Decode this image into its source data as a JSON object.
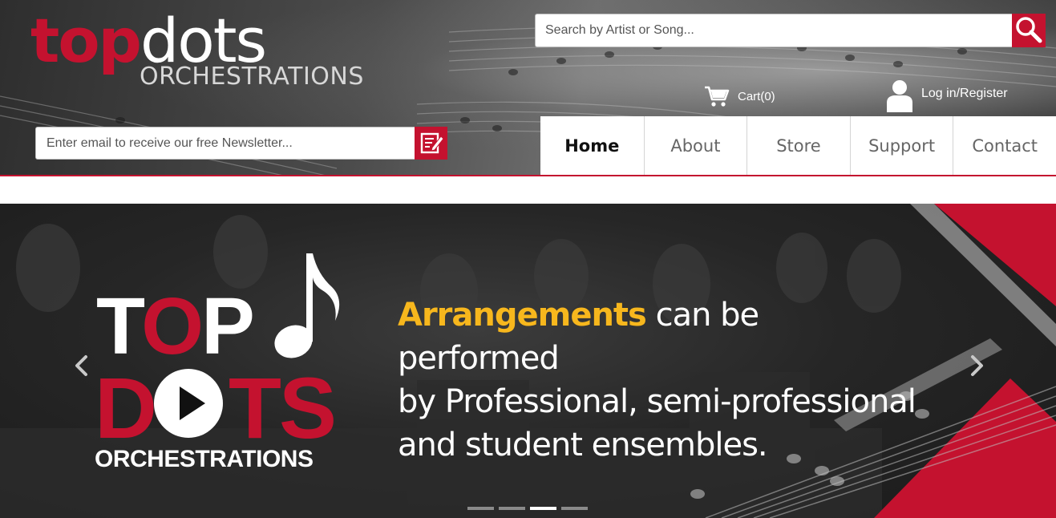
{
  "header": {
    "logo": {
      "part1": "top",
      "part2": "dots",
      "subtitle": "ORCHESTRATIONS"
    },
    "search": {
      "placeholder": "Search by Artist or Song...",
      "value": ""
    },
    "cart": {
      "label": "Cart(0)"
    },
    "account": {
      "label": "Log in/Register"
    },
    "newsletter": {
      "placeholder": "Enter email to receive our free Newsletter...",
      "value": ""
    },
    "nav": [
      {
        "label": "Home",
        "active": true
      },
      {
        "label": "About",
        "active": false
      },
      {
        "label": "Store",
        "active": false
      },
      {
        "label": "Support",
        "active": false
      },
      {
        "label": "Contact",
        "active": false
      }
    ]
  },
  "hero": {
    "logo": {
      "top_t": "T",
      "top_o": "O",
      "top_p": "P",
      "dots_d": "D",
      "dots_ts": "TS",
      "subtitle": "ORCHESTRATIONS"
    },
    "text": {
      "highlight": "Arrangements",
      "line1": " can be performed",
      "line2": "by Professional, semi-professional",
      "line3": "and student ensembles."
    },
    "slides": {
      "count": 4,
      "active_index": 2
    }
  },
  "colors": {
    "brand_red": "#c4122f",
    "highlight_yellow": "#f7b71d",
    "nav_text": "#666666"
  },
  "icons": {
    "search": "magnifier-icon",
    "cart": "cart-icon",
    "user": "user-icon",
    "newsletter": "edit-note-icon",
    "prev": "chevron-left-icon",
    "next": "chevron-right-icon"
  }
}
